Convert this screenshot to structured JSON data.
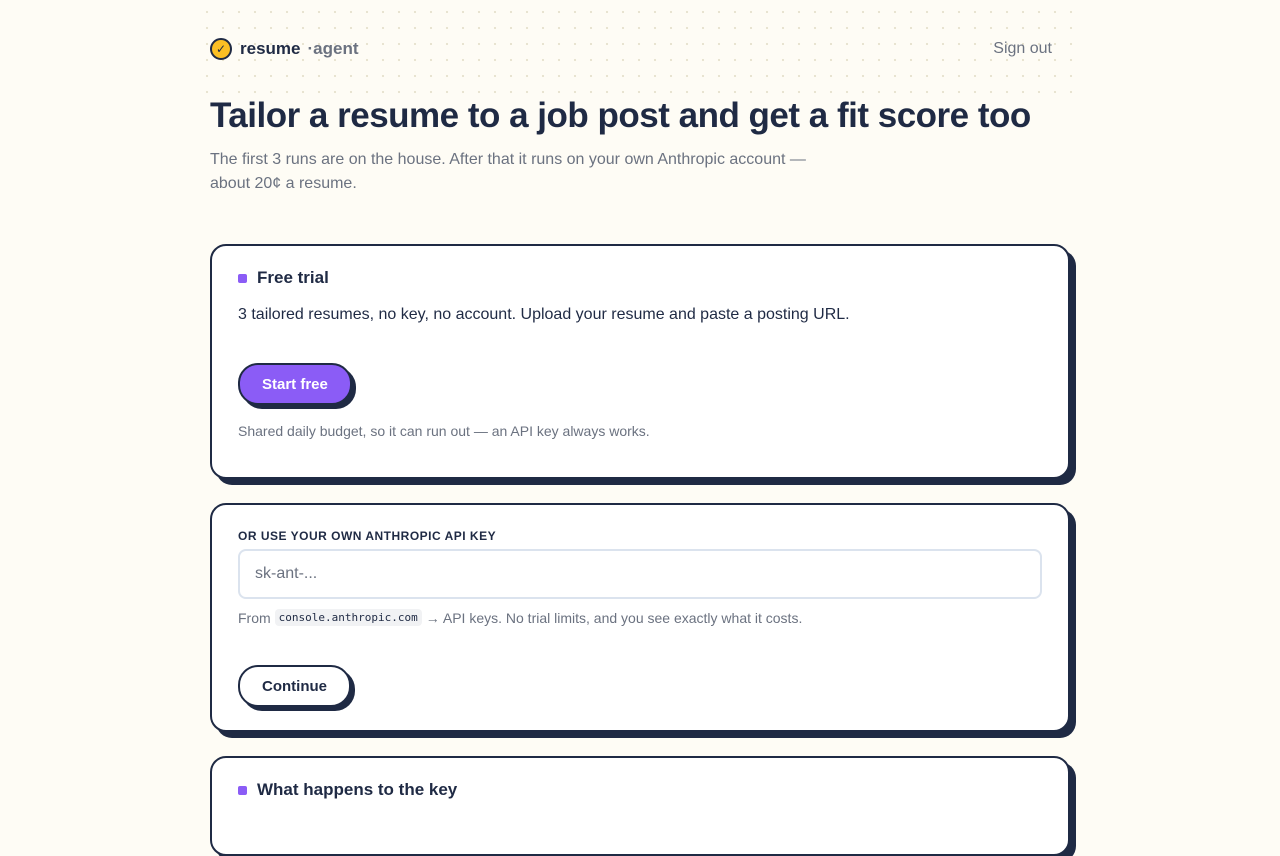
{
  "header": {
    "logo_icon": "check-icon",
    "brand_name": "resume",
    "brand_suffix": "·agent",
    "signout_label": "Sign out"
  },
  "hero": {
    "title": "Tailor a resume to a job post and get a fit score too",
    "subtitle": "The first 3 runs are on the house. After that it runs on your own Anthropic account — about 20¢ a resume."
  },
  "trial_card": {
    "title": "Free trial",
    "description": "3 tailored resumes, no key, no account. Upload your resume and paste a posting URL.",
    "button_label": "Start free",
    "note": "Shared daily budget, so it can run out — an API key always works."
  },
  "api_card": {
    "label": "OR USE YOUR OWN ANTHROPIC API KEY",
    "input_placeholder": "sk-ant-...",
    "input_value": "",
    "help_prefix": "From",
    "help_code": "console.anthropic.com",
    "help_suffix": "→ API keys. No trial limits, and you see exactly what it costs.",
    "button_label": "Continue"
  },
  "key_card": {
    "title": "What happens to the key"
  },
  "colors": {
    "accent": "#8b5cf6",
    "ink": "#1f2a44",
    "logo": "#fbbf24",
    "background": "#fefcf5"
  }
}
